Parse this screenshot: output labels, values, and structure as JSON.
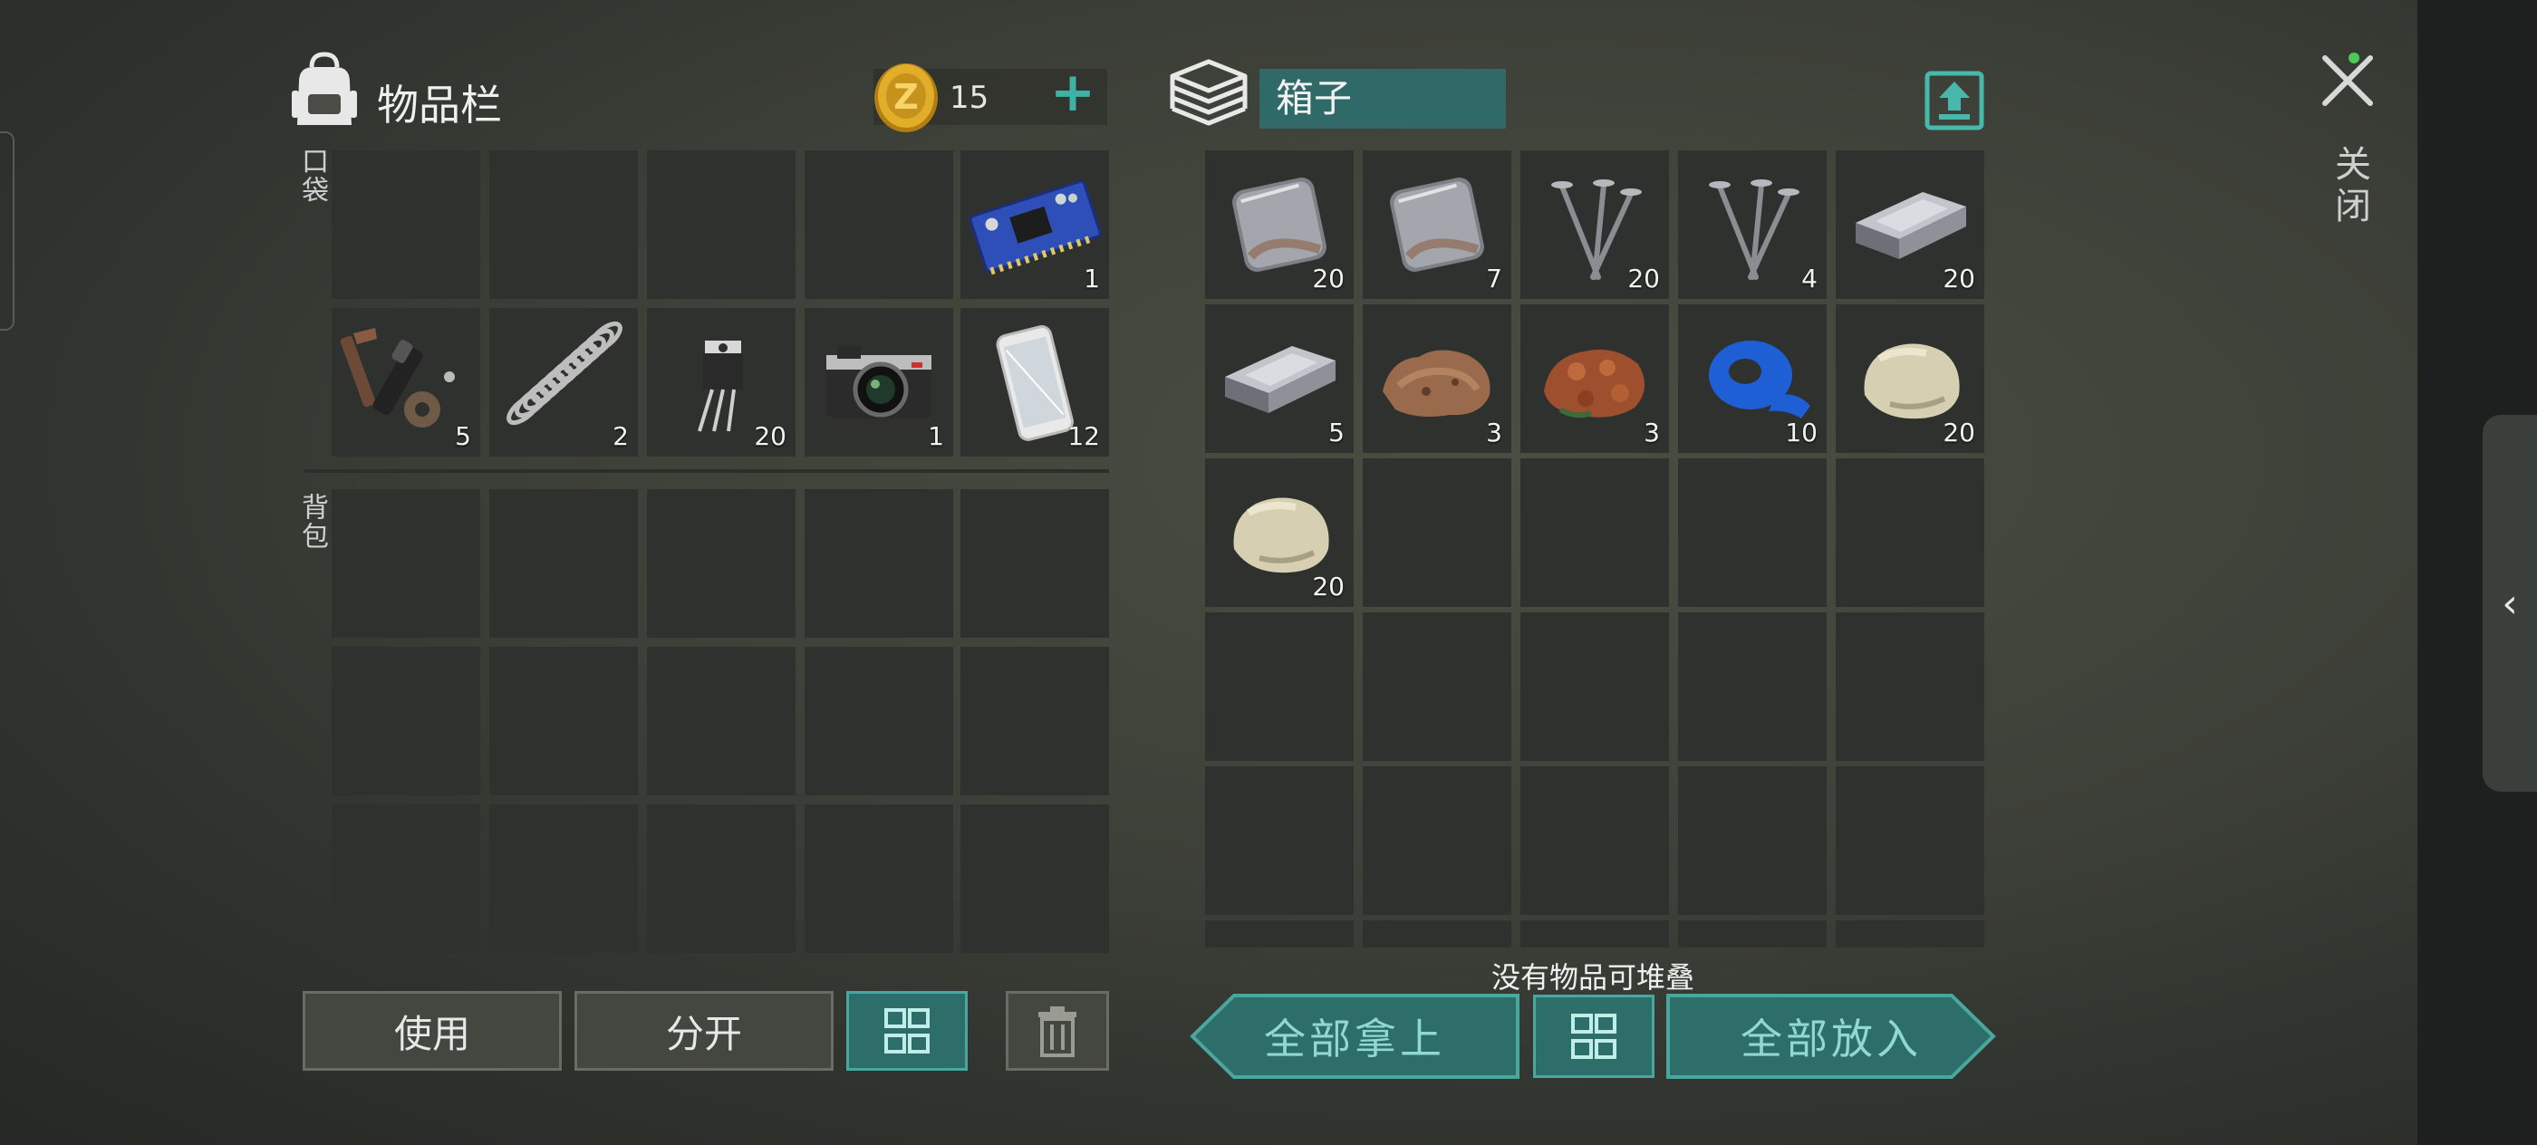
{
  "inventory": {
    "title": "物品栏",
    "coins": "15",
    "add_label": "+",
    "pocket_label": "口袋",
    "backpack_label": "背包",
    "pocket_items": [
      {
        "icon": "",
        "qty": ""
      },
      {
        "icon": "",
        "qty": ""
      },
      {
        "icon": "",
        "qty": ""
      },
      {
        "icon": "",
        "qty": ""
      },
      {
        "icon": "circuit-board-icon",
        "qty": "1"
      },
      {
        "icon": "spare-parts-icon",
        "qty": "5"
      },
      {
        "icon": "spring-icon",
        "qty": "2"
      },
      {
        "icon": "transistor-icon",
        "qty": "20"
      },
      {
        "icon": "camera-icon",
        "qty": "1"
      },
      {
        "icon": "smartphone-icon",
        "qty": "12"
      }
    ]
  },
  "chest": {
    "name": "箱子",
    "items": [
      {
        "icon": "iron-plate-icon",
        "qty": "20"
      },
      {
        "icon": "iron-plate-icon",
        "qty": "7"
      },
      {
        "icon": "nails-icon",
        "qty": "20"
      },
      {
        "icon": "nails-icon",
        "qty": "4"
      },
      {
        "icon": "steel-ingot-icon",
        "qty": "20"
      },
      {
        "icon": "steel-ingot-icon",
        "qty": "5"
      },
      {
        "icon": "copper-ore-icon",
        "qty": "3"
      },
      {
        "icon": "iron-ore-icon",
        "qty": "3"
      },
      {
        "icon": "duct-tape-icon",
        "qty": "10"
      },
      {
        "icon": "stone-icon",
        "qty": "20"
      },
      {
        "icon": "stone-icon",
        "qty": "20"
      }
    ],
    "no_stack_msg": "没有物品可堆叠"
  },
  "buttons": {
    "use": "使用",
    "split": "分开",
    "take_all": "全部拿上",
    "put_all": "全部放入"
  },
  "close_label": "关闭",
  "side_tab_arrow": "‹",
  "colors": {
    "teal": "#2d6d6a",
    "teal_border": "#48a79e",
    "slot": "#2f312e",
    "coin": "#d9a521"
  }
}
